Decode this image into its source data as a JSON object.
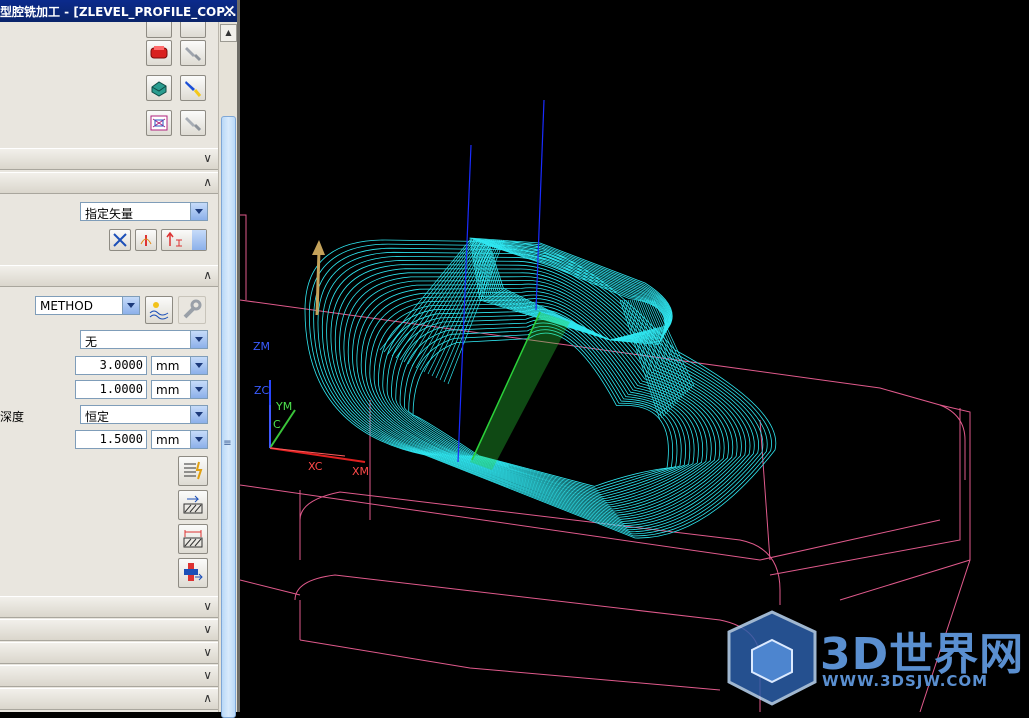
{
  "dialog": {
    "title": "型腔铣加工 - [ZLEVEL_PROFILE_COP...",
    "close": "×"
  },
  "cut_direction": {
    "vector_select": "指定矢量"
  },
  "method_section": {
    "method_select": "METHOD"
  },
  "params": {
    "row1_select": "无",
    "row2_value": "3.0000",
    "row2_unit": "mm",
    "row3_value": "1.0000",
    "row3_unit": "mm",
    "row4_label_fragment": "深度",
    "row4_select": "恒定",
    "row5_value": "1.5000",
    "row5_unit": "mm"
  },
  "viewport": {
    "axis_labels": {
      "zm": "ZM",
      "zc": "ZC",
      "ym": "YM",
      "c": "C",
      "xc": "XC",
      "xm": "XM"
    },
    "watermark": {
      "brand": "3D世界网",
      "url": "WWW.3DSJW.COM"
    },
    "colors": {
      "toolpath": "#2fe6f0",
      "blank": "#e05a8c",
      "tool_axis": "#1a2cff",
      "cut_line": "#2bd13a"
    }
  }
}
